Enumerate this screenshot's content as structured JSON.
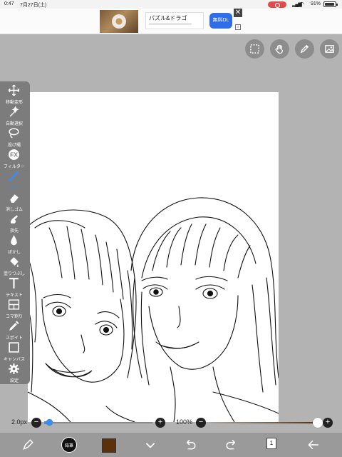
{
  "status_bar": {
    "time": "0:47",
    "date": "7月27日(土)",
    "battery": "91%"
  },
  "ad": {
    "title": "パズル&ドラゴ",
    "download_label": "無料DL"
  },
  "toolbar": {
    "items": [
      {
        "label": "移動変形",
        "icon": "move-icon"
      },
      {
        "label": "自動選択",
        "icon": "magic-wand-icon"
      },
      {
        "label": "投げ縄",
        "icon": "lasso-icon"
      },
      {
        "label": "フィルター",
        "icon": "fx-icon"
      },
      {
        "label": "ペン",
        "icon": "pen-icon"
      },
      {
        "label": "消しゴム",
        "icon": "eraser-icon"
      },
      {
        "label": "指先",
        "icon": "finger-icon"
      },
      {
        "label": "ぼかし",
        "icon": "blur-drop-icon"
      },
      {
        "label": "塗りつぶし",
        "icon": "bucket-icon"
      },
      {
        "label": "テキスト",
        "icon": "text-icon"
      },
      {
        "label": "コマ割り",
        "icon": "frame-divide-icon"
      },
      {
        "label": "スポイト",
        "icon": "eyedropper-icon"
      },
      {
        "label": "キャンバス",
        "icon": "canvas-icon"
      },
      {
        "label": "設定",
        "icon": "gear-icon"
      }
    ]
  },
  "brush_size": {
    "value_label": "2.0px",
    "fraction": 0.03
  },
  "opacity": {
    "value_label": "100%",
    "fraction": 1.0
  },
  "bottom_bar": {
    "brush_label": "鉛筆",
    "layer_number": "1",
    "color": "#5b300c"
  },
  "colors": {
    "toolbar_bg": "#7c7c7c",
    "workspace_bg": "#b3b3b3",
    "accent_blue": "#3b8cf0"
  }
}
